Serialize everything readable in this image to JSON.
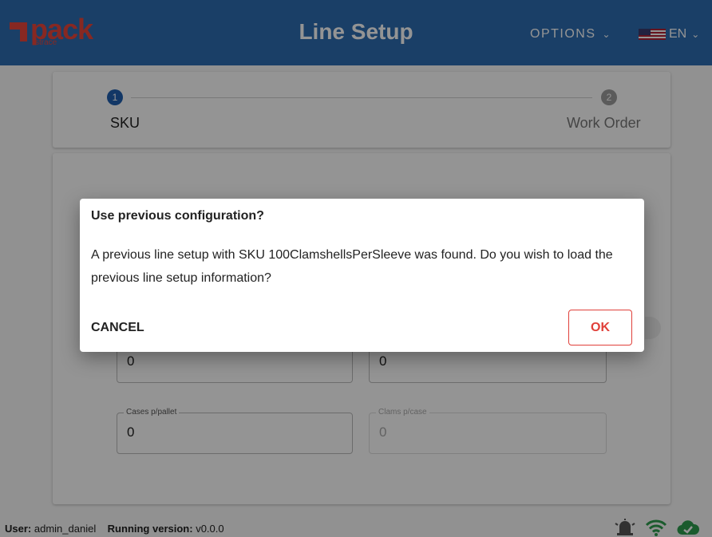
{
  "header": {
    "logo_text": "pack",
    "logo_sub": "strace",
    "title": "Line Setup",
    "options_label": "OPTIONS",
    "language": "EN",
    "brand_color": "#2d6db2"
  },
  "stepper": {
    "steps": [
      {
        "number": "1",
        "label": "SKU"
      },
      {
        "number": "2",
        "label": "Work Order"
      }
    ]
  },
  "form": {
    "fields": [
      {
        "label": "",
        "value": "0"
      },
      {
        "label": "",
        "value": "0"
      },
      {
        "label": "Cases p/pallet",
        "value": "0"
      },
      {
        "label": "Clams p/case",
        "value": "0"
      }
    ]
  },
  "dialog": {
    "title": "Use previous configuration?",
    "body": "A previous line setup with SKU 100ClamshellsPerSleeve was found. Do you wish to load the previous line setup information?",
    "cancel_label": "CANCEL",
    "ok_label": "OK"
  },
  "footer": {
    "user_label": "User:",
    "user_value": "admin_daniel",
    "version_label": "Running version:",
    "version_value": "v0.0.0",
    "icons": [
      "alarm-icon",
      "wifi-icon",
      "cloud-check-icon"
    ]
  }
}
